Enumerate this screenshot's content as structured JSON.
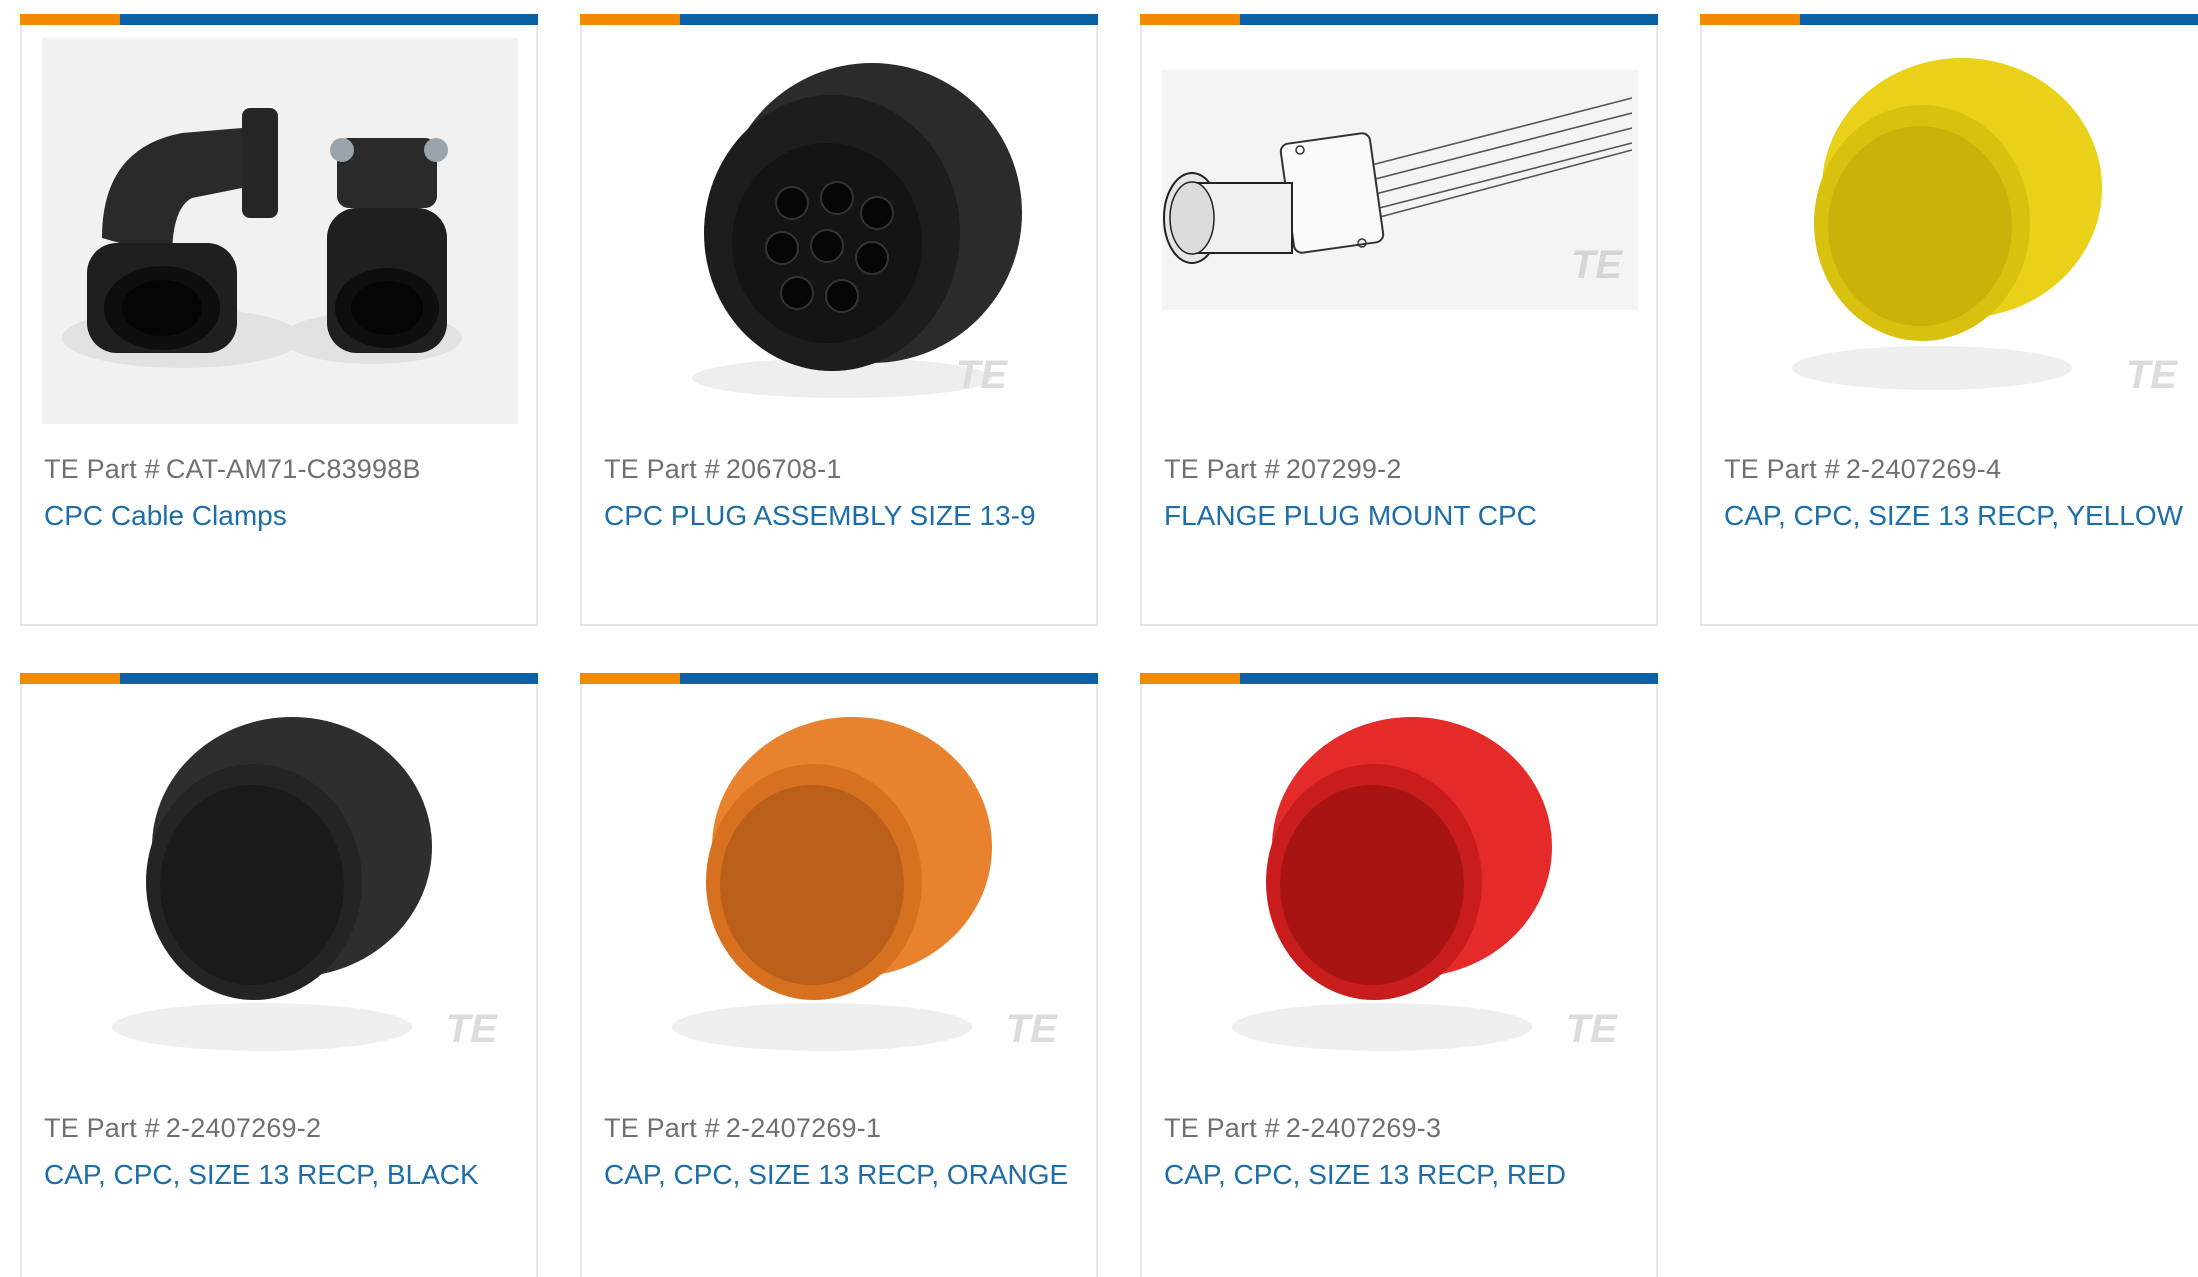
{
  "colors": {
    "accent_orange": "#f08a00",
    "accent_blue": "#0c60a3",
    "link": "#1d6da8",
    "part_text": "#707070",
    "card_border": "#e7e7e7"
  },
  "part_label": "TE Part #",
  "products": [
    {
      "part_number": "CAT-AM71-C83998B",
      "title": "CPC Cable Clamps",
      "image": "cable-clamps-image"
    },
    {
      "part_number": "206708-1",
      "title": "CPC PLUG ASSEMBLY SIZE 13-9",
      "image": "plug-assembly-image"
    },
    {
      "part_number": "207299-2",
      "title": "FLANGE PLUG MOUNT CPC",
      "image": "flange-plug-drawing"
    },
    {
      "part_number": "2-2407269-4",
      "title": "CAP, CPC, SIZE 13 RECP, YELLOW",
      "image": "yellow-cap-image"
    },
    {
      "part_number": "2-2407269-2",
      "title": "CAP, CPC, SIZE 13 RECP, BLACK",
      "image": "black-cap-image"
    },
    {
      "part_number": "2-2407269-1",
      "title": "CAP, CPC, SIZE 13 RECP, ORANGE",
      "image": "orange-cap-image"
    },
    {
      "part_number": "2-2407269-3",
      "title": "CAP, CPC, SIZE 13 RECP, RED",
      "image": "red-cap-image"
    }
  ],
  "watermark": "TE",
  "cap_colors": {
    "yellow": "#f2dc1a",
    "black": "#2c2c2c",
    "orange": "#e57f2e",
    "red": "#df2626"
  }
}
